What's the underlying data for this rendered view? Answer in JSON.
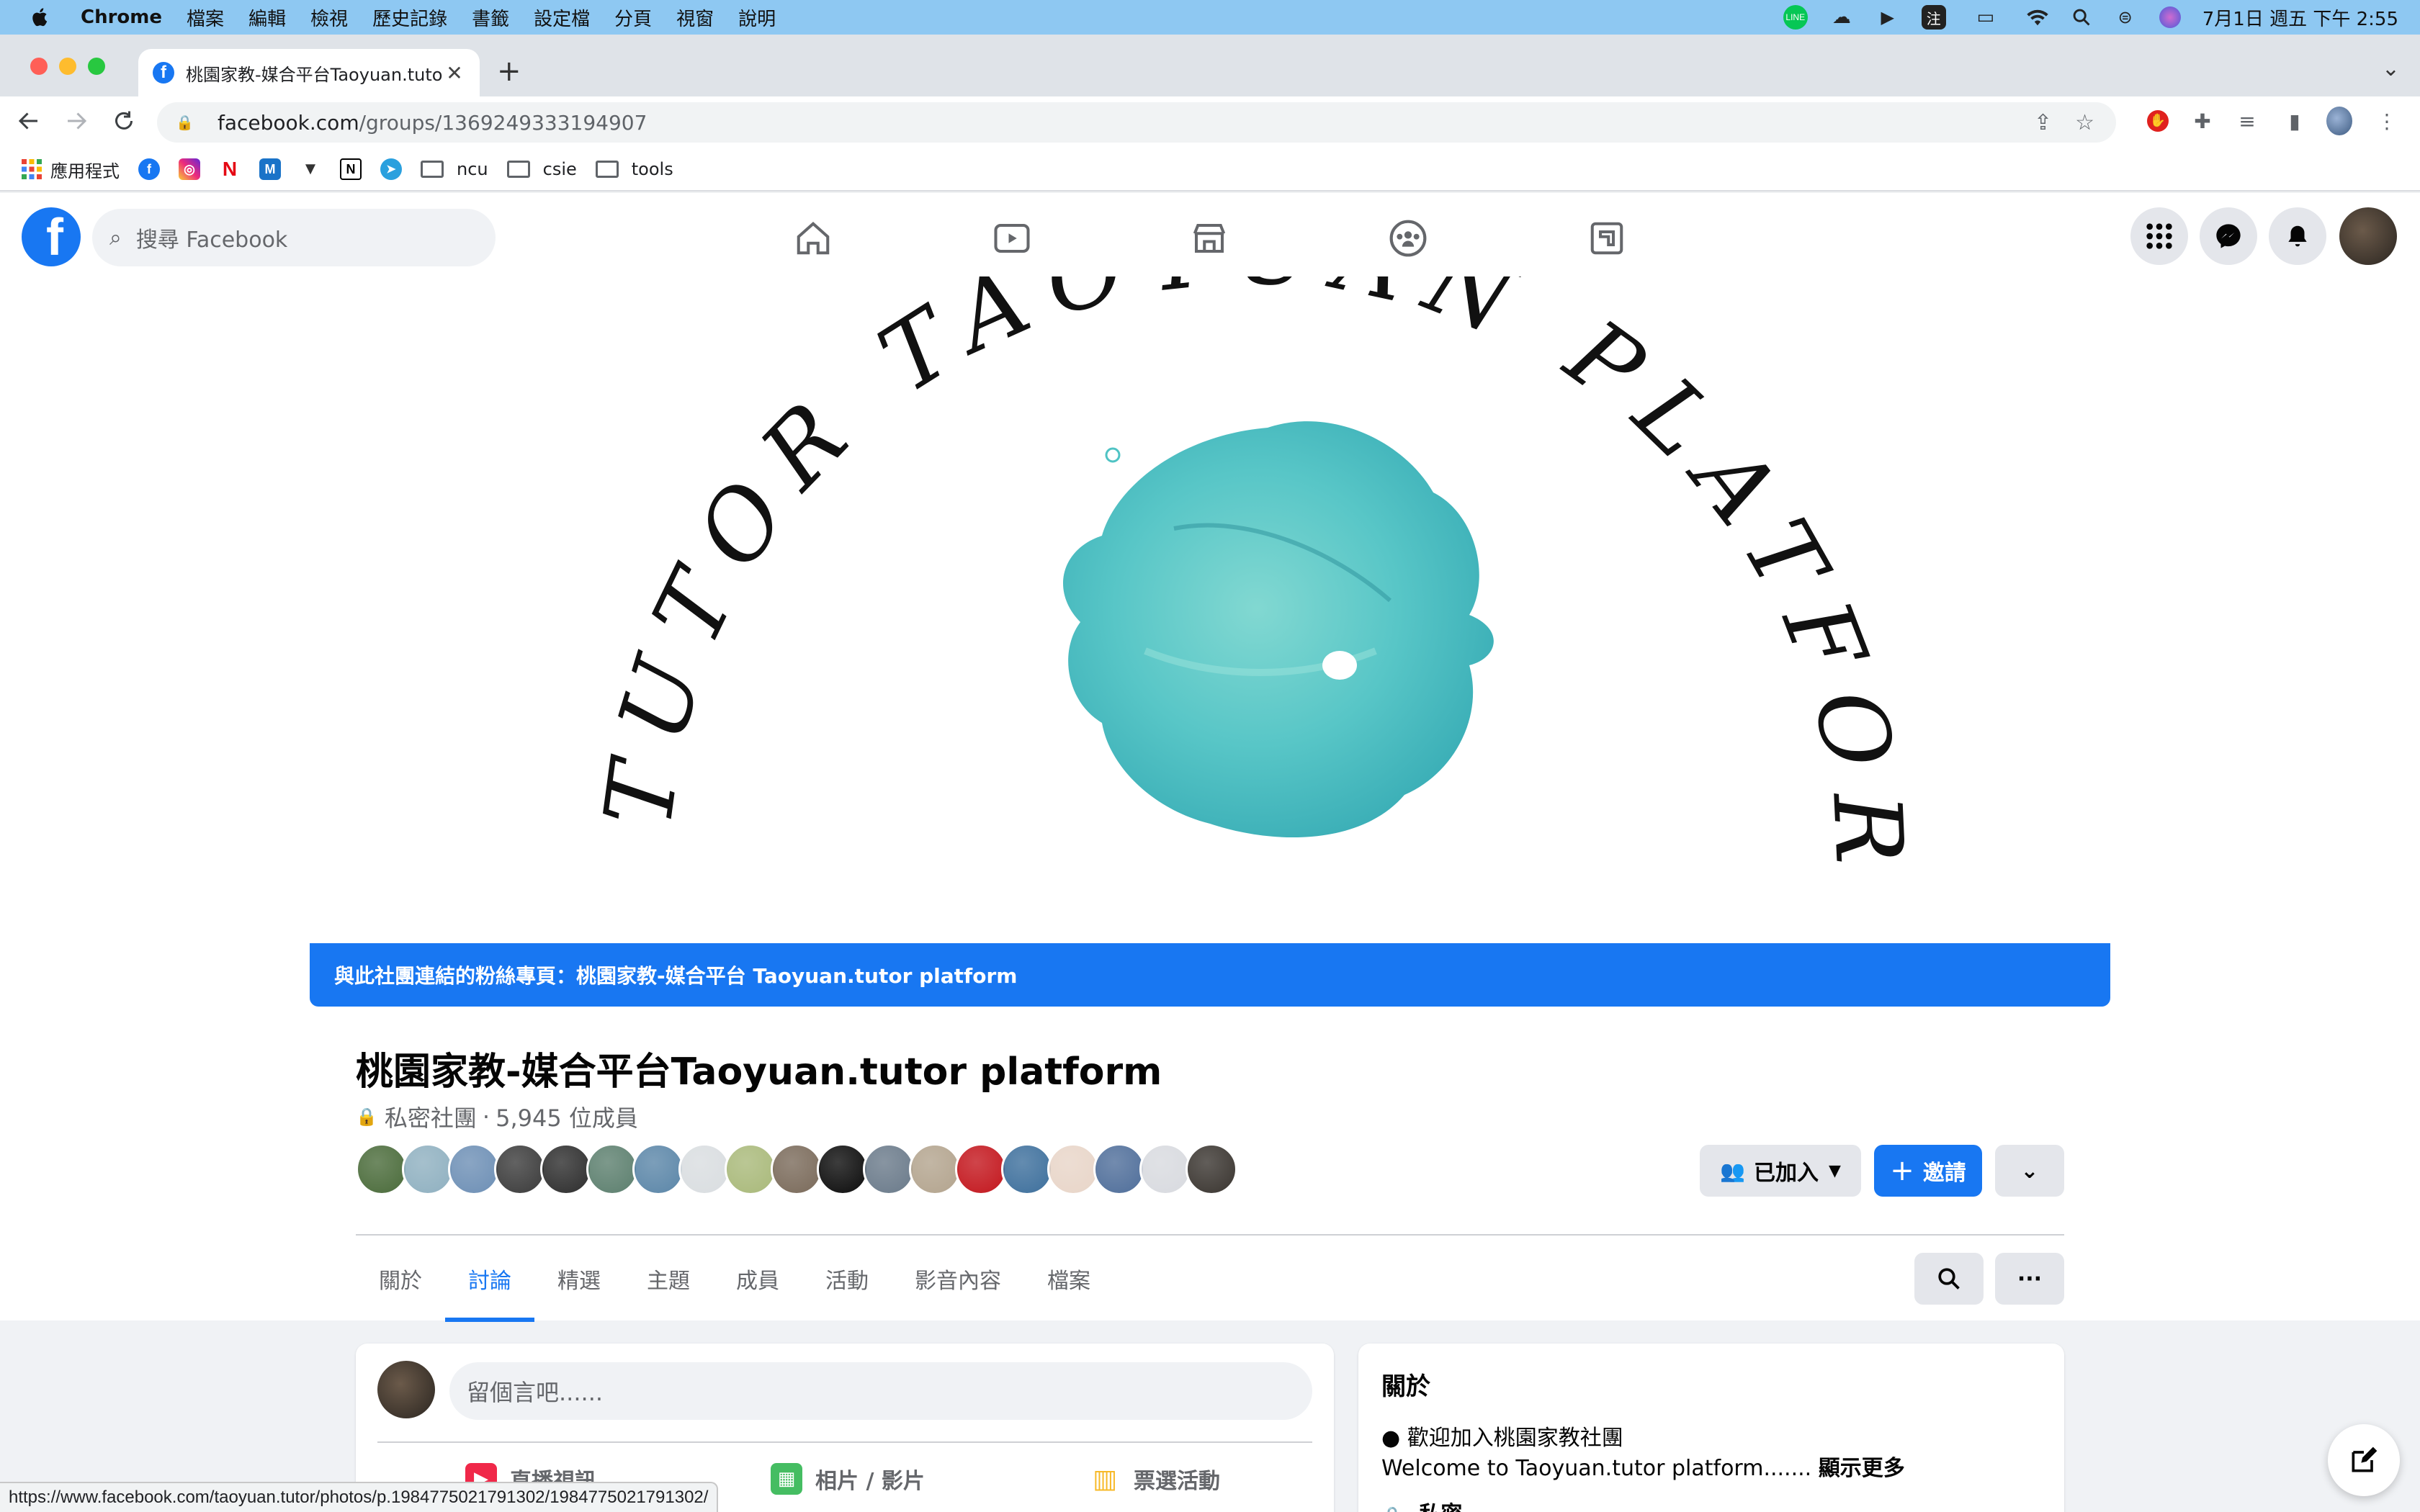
{
  "menubar": {
    "app": "Chrome",
    "items": [
      "檔案",
      "編輯",
      "檢視",
      "歷史記錄",
      "書籤",
      "設定檔",
      "分頁",
      "視窗",
      "說明"
    ],
    "clock": "7月1日 週五 下午 2:55"
  },
  "browser": {
    "tab_title": "桃園家教-媒合平台Taoyuan.tuto",
    "url_host": "facebook.com",
    "url_path": "/groups/1369249333194907",
    "bookmarks": {
      "apps_label": "應用程式",
      "folders": [
        "ncu",
        "csie",
        "tools"
      ]
    },
    "status_url": "https://www.facebook.com/taoyuan.tutor/photos/p.1984775021791302/1984775021791302/"
  },
  "fb": {
    "search_placeholder": "搜尋 Facebook"
  },
  "group": {
    "linked_page_text": "與此社團連結的粉絲專頁：桃園家教-媒合平台 Taoyuan.tutor platform",
    "name": "桃園家教-媒合平台Taoyuan.tutor platform",
    "privacy": "私密社團",
    "separator": "·",
    "member_count": "5,945 位成員",
    "joined_label": "已加入",
    "invite_label": "邀請",
    "tabs": [
      "關於",
      "討論",
      "精選",
      "主題",
      "成員",
      "活動",
      "影音內容",
      "檔案"
    ],
    "active_tab": "討論",
    "member_colors": [
      "#4a6b3a",
      "#8fb0c0",
      "#6d8fb5",
      "#3b3b3b",
      "#2d2d2d",
      "#5c7f6e",
      "#5b86a8",
      "#d9dde0",
      "#a9b97a",
      "#7a6a5a",
      "#0c0c0c",
      "#6a7a8a",
      "#b3a48e",
      "#c3161d",
      "#3d6f9c",
      "#e8d5c8",
      "#4f6e9a",
      "#d8dadf",
      "#3a3530"
    ]
  },
  "composer": {
    "placeholder": "留個言吧......",
    "actions": [
      "直播視訊",
      "相片 / 影片",
      "票選活動"
    ]
  },
  "about": {
    "heading": "關於",
    "line1": "● 歡迎加入桃園家教社團",
    "line2": "Welcome to Taoyuan.tutor platform.......",
    "see_more": "顯示更多",
    "line3": "私密"
  },
  "colors": {
    "fb_blue": "#1877f2",
    "menubar": "#8ec8f2",
    "cover_splash": "#4fc3c4"
  },
  "cover_text": "TUTOR TAOYUAN PLATFORM"
}
